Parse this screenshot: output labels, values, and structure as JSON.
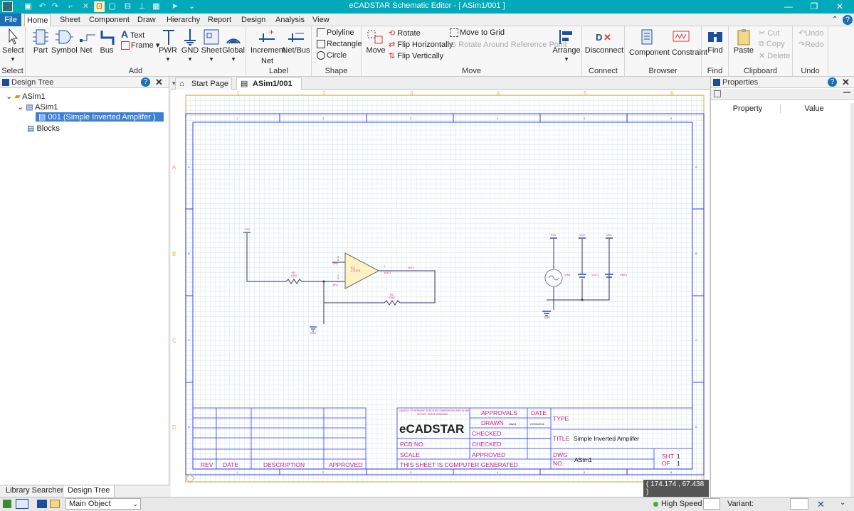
{
  "app": {
    "title": "eCADSTAR Schematic Editor - [ ASim1/001 ]"
  },
  "menu": {
    "file": "File",
    "tabs": [
      "Home",
      "Sheet",
      "Component",
      "Draw",
      "Hierarchy",
      "Report",
      "Design",
      "Analysis",
      "View"
    ]
  },
  "ribbon": {
    "select": {
      "label": "Select",
      "group": "Select"
    },
    "add": {
      "part": "Part",
      "symbol": "Symbol",
      "net": "Net",
      "bus": "Bus",
      "text": "Text",
      "frame": "Frame",
      "pwr": "PWR",
      "gnd": "GND",
      "sheet": "Sheet",
      "global": "Global",
      "group": "Add"
    },
    "label": {
      "increment": "Increment",
      "netbus": "Net/Bus",
      "net": "Net",
      "group": "Label"
    },
    "shape": {
      "polyline": "Polyline",
      "rectangle": "Rectangle",
      "circle": "Circle",
      "group": "Shape"
    },
    "move": {
      "move": "Move",
      "rotate": "Rotate",
      "flip_h": "Flip Horizontally",
      "flip_v": "Flip Vertically",
      "move_grid": "Move to Grid",
      "rotate_ref": "Rotate Around Reference Point",
      "arrange": "Arrange",
      "group": "Move"
    },
    "connect": {
      "disconnect": "Disconnect",
      "group": "Connect"
    },
    "browser": {
      "component_constraint": "Component Constraint",
      "group": "Browser"
    },
    "find": {
      "find": "Find",
      "group": "Find"
    },
    "clipboard": {
      "paste": "Paste",
      "cut": "Cut",
      "copy": "Copy",
      "delete": "Delete",
      "group": "Clipboard"
    },
    "undo": {
      "undo": "Undo",
      "redo": "Redo",
      "group": "Undo"
    }
  },
  "design_tree": {
    "title": "Design Tree",
    "root": "ASim1",
    "child": "ASim1",
    "sheet": "001 (Simple Inverted Amplifer )",
    "blocks": "Blocks"
  },
  "bottom_tabs": [
    "Library Searcher",
    "Design Tree"
  ],
  "doc_tabs": [
    {
      "label": "Start Page"
    },
    {
      "label": "ASim1/001"
    }
  ],
  "properties": {
    "title": "Properties",
    "col_property": "Property",
    "col_value": "Value"
  },
  "schematic": {
    "ruler_cols": [
      "1",
      "2",
      "3",
      "4",
      "5",
      "6"
    ],
    "ruler_rows": [
      "A",
      "B",
      "C",
      "D"
    ],
    "labels": {
      "vin_top": "VIN",
      "r1": "R1",
      "r1_val": "10K0",
      "ic1": "IC1",
      "ic1_part": "LT1013",
      "in_plus": "1IN+",
      "in_minus": "1IN-",
      "out_pin": "1OUT",
      "pin3": "3",
      "pin2": "2",
      "pin1": "1",
      "pin8": "8",
      "pin4": "4",
      "out_net": "OUT",
      "r2": "R2",
      "r2_val": "33K0",
      "gnd": "GND",
      "vin_src": "VIN",
      "vcc": "VCC",
      "vee": "VEE",
      "vin1": "VIN1",
      "vcc1": "VCC1",
      "vee1": "VEE1",
      "gnd2": "GND"
    },
    "titleblock": {
      "approvals": "APPROVALS",
      "date": "DATE",
      "drawn": "DRAWN",
      "drawn_by": "User1",
      "drawn_date": "27/01/2011",
      "checked1": "CHECKED",
      "checked2": "CHECKED",
      "approved": "APPROVED",
      "pcb_no": "PCB NO.",
      "scale": "SCALE",
      "computer": "THIS SHEET IS COMPUTER GENERATED",
      "unless": "UNLESS OTHERWISE SPECIFIED DIMENSIONS ARE IN MM",
      "do_not": "DO NOT SCALE DRAWING",
      "logo": "eCADSTAR",
      "type": "TYPE",
      "title_label": "TITLE",
      "title_value": "Simple Inverted Amplifer",
      "dwg_no": "DWG",
      "dwg_no2": "NO.",
      "dwg_value": "ASim1",
      "sht": "SHT",
      "sht_value": "1",
      "of": "OF",
      "of_value": "1",
      "rev": "REV",
      "rev_date": "DATE",
      "description": "DESCRIPTION",
      "rev_approved": "APPROVED"
    },
    "coordinates": "( 174.174 , 67.438 )"
  },
  "status": {
    "main_object": "Main Object",
    "high_speed": "High Speed",
    "variant": "Variant:"
  },
  "colors": {
    "titlebar": "#00aabb",
    "frame": "#3b3bff",
    "grid": "#b9dada",
    "label": "#cc2288",
    "wire": "#333366",
    "opamp_fill": "#fff2c4"
  }
}
